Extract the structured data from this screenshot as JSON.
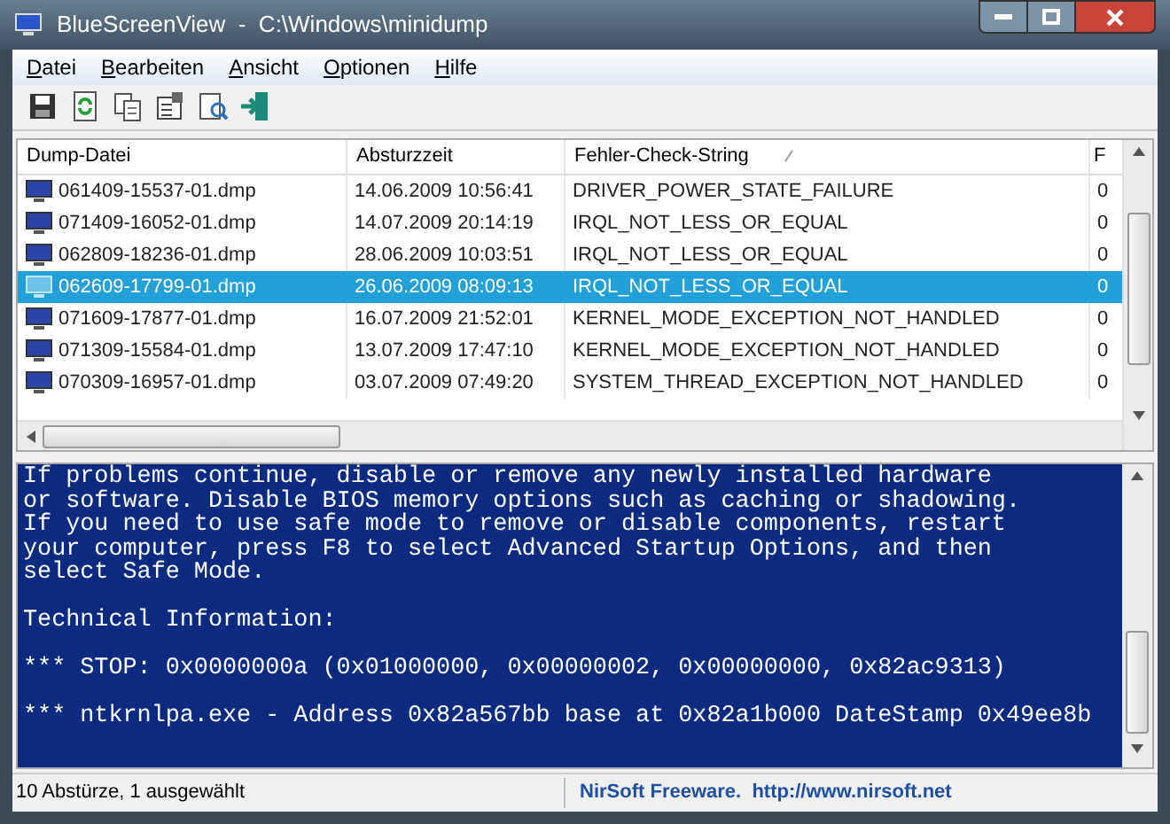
{
  "window": {
    "title": "BlueScreenView  -  C:\\Windows\\minidump"
  },
  "menu": [
    "Datei",
    "Bearbeiten",
    "Ansicht",
    "Optionen",
    "Hilfe"
  ],
  "toolbar": [
    {
      "kind": "save"
    },
    {
      "kind": "refresh"
    },
    {
      "kind": "copy"
    },
    {
      "kind": "properties"
    },
    {
      "kind": "report"
    },
    {
      "kind": "exit"
    }
  ],
  "table": {
    "columns": [
      {
        "label": "Dump-Datei",
        "sorted": false
      },
      {
        "label": "Absturzzeit",
        "sorted": false
      },
      {
        "label": "Fehler-Check-String",
        "sorted": true
      },
      {
        "label": "F",
        "sorted": false
      }
    ],
    "rows": [
      {
        "cells": [
          "061409-15537-01.dmp",
          "14.06.2009 10:56:41",
          "DRIVER_POWER_STATE_FAILURE",
          "0"
        ],
        "selected": false
      },
      {
        "cells": [
          "071409-16052-01.dmp",
          "14.07.2009 20:14:19",
          "IRQL_NOT_LESS_OR_EQUAL",
          "0"
        ],
        "selected": false
      },
      {
        "cells": [
          "062809-18236-01.dmp",
          "28.06.2009 10:03:51",
          "IRQL_NOT_LESS_OR_EQUAL",
          "0"
        ],
        "selected": false
      },
      {
        "cells": [
          "062609-17799-01.dmp",
          "26.06.2009 08:09:13",
          "IRQL_NOT_LESS_OR_EQUAL",
          "0"
        ],
        "selected": true
      },
      {
        "cells": [
          "071609-17877-01.dmp",
          "16.07.2009 21:52:01",
          "KERNEL_MODE_EXCEPTION_NOT_HANDLED",
          "0"
        ],
        "selected": false
      },
      {
        "cells": [
          "071309-15584-01.dmp",
          "13.07.2009 17:47:10",
          "KERNEL_MODE_EXCEPTION_NOT_HANDLED",
          "0"
        ],
        "selected": false
      },
      {
        "cells": [
          "070309-16957-01.dmp",
          "03.07.2009 07:49:20",
          "SYSTEM_THREAD_EXCEPTION_NOT_HANDLED",
          "0"
        ],
        "selected": false
      }
    ]
  },
  "bluescreen": [
    [
      "If problems continue, disable or remove any newly installed hardware",
      "or software. Disable BIOS memory options such as caching or shadowing.",
      "If you need to use safe mode to remove or disable components, restart",
      "your computer, press F8 to select Advanced Startup Options, and then",
      "select Safe Mode."
    ],
    [
      "Technical Information:"
    ],
    [
      "*** STOP: 0x0000000a (0x01000000, 0x00000002, 0x00000000, 0x82ac9313)"
    ],
    [
      "*** ntkrnlpa.exe - Address 0x82a567bb base at 0x82a1b000 DateStamp 0x49ee8b"
    ]
  ],
  "status_bar": {
    "count": "10 Abstürze, 1 ausgewählt",
    "credit": "NirSoft Freeware.  http://www.nirsoft.net"
  }
}
